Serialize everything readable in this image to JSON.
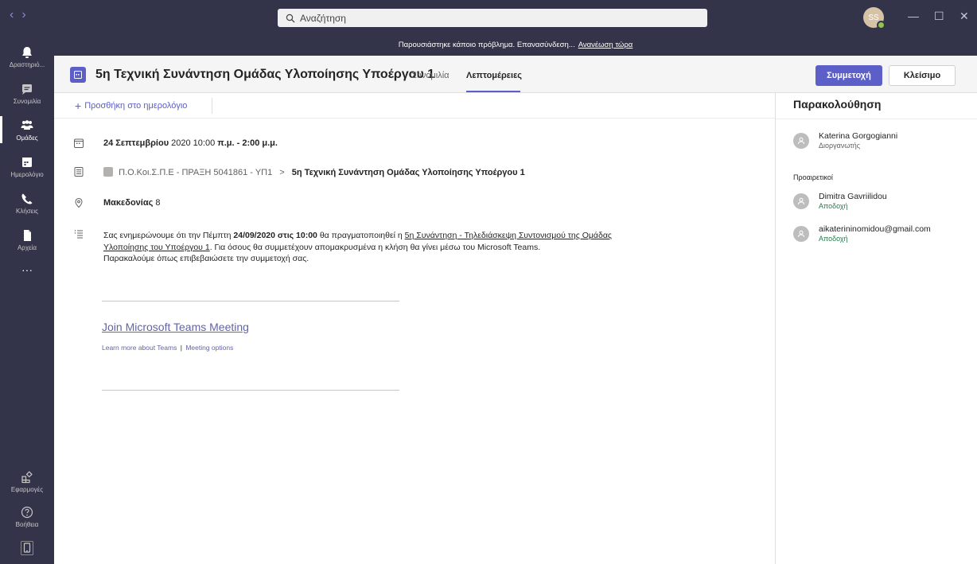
{
  "titlebar": {
    "search_placeholder": "Αναζήτηση",
    "avatar_initials": "SS",
    "back_glyph": "‹",
    "forward_glyph": "›",
    "minimize_glyph": "—",
    "maximize_glyph": "☐",
    "close_glyph": "✕"
  },
  "rail": {
    "items": [
      {
        "label": "Δραστηριό...",
        "icon": "bell-icon"
      },
      {
        "label": "Συνομιλία",
        "icon": "chat-icon"
      },
      {
        "label": "Ομάδες",
        "icon": "teams-icon"
      },
      {
        "label": "Ημερολόγιο",
        "icon": "calendar-icon"
      },
      {
        "label": "Κλήσεις",
        "icon": "phone-icon"
      },
      {
        "label": "Αρχεία",
        "icon": "file-icon"
      }
    ],
    "more_label": "···",
    "apps_label": "Εφαρμογές",
    "help_label": "Βοήθεια"
  },
  "banner": {
    "message": "Παρουσιάστηκε κάποιο πρόβλημα. Επανασύνδεση...",
    "link": "Ανανέωση τώρα"
  },
  "header": {
    "title": "5η Τεχνική Συνάντηση Ομάδας Υλοποίησης Υποέργου 1",
    "tabs": [
      {
        "label": "Συνομιλία",
        "active": false
      },
      {
        "label": "Λεπτομέρειες",
        "active": true
      }
    ],
    "join_label": "Συμμετοχή",
    "close_label": "Κλείσιμο"
  },
  "toolbar": {
    "add_to_calendar": "Προσθήκη στο ημερολόγιο",
    "add_glyph": "+"
  },
  "details": {
    "date_bold": "24 Σεπτεμβρίου",
    "date_rest": "2020 10:00",
    "time_bold": "π.μ. - 2:00 μ.μ.",
    "channel_team": "Π.Ο.Κοι.Σ.Π.Ε - ΠΡΑΞΗ 5041861 - ΥΠ1",
    "channel_sep": ">",
    "channel_name": "5η Τεχνική Συνάντηση Ομάδας Υλοποίησης Υποέργου 1",
    "location_bold": "Μακεδονίας",
    "location_rest": "8",
    "desc_p1": "Σας ενημερώνουμε ότι την Πέμπτη",
    "desc_date": "24/09/2020 στις 10:00",
    "desc_p2": "θα πραγματοποιηθεί η",
    "desc_link1": "5η Συνάντηση - Τηλεδιάσκεψη Συντονισμού της Ομάδας",
    "desc_link2": "Υλοποίησης του Υποέργου 1",
    "desc_p3": ". Για όσους θα συμμετέχουν απομακρυσμένα η κλήση θα γίνει μέσω του Microsoft Teams.",
    "desc_p4": "Παρακαλούμε όπως επιβεβαιώσετε την συμμετοχή σας.",
    "join_link": "Join Microsoft Teams Meeting",
    "learn_more": "Learn more about Teams",
    "pipe": "|",
    "meeting_options": "Meeting options"
  },
  "tracking": {
    "title": "Παρακολούθηση",
    "organizer": {
      "name": "Katerina Gorgogianni",
      "role": "Διοργανωτής"
    },
    "optional_label": "Προαιρετικοί",
    "attendees": [
      {
        "name": "Dimitra Gavriilidou",
        "status": "Αποδοχή"
      },
      {
        "name": "aikaterininomidou@gmail.com",
        "status": "Αποδοχή"
      }
    ]
  },
  "colors": {
    "accent": "#5b5fc7",
    "rail": "#33344a",
    "accepted": "#237b4b"
  }
}
